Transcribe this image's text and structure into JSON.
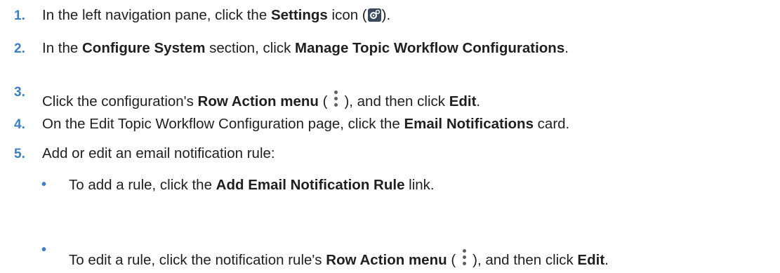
{
  "steps": [
    {
      "num": "1.",
      "parts": [
        "In the left navigation pane, click the ",
        "Settings",
        " icon (",
        ")."
      ]
    },
    {
      "num": "2.",
      "parts": [
        "In the ",
        "Configure System",
        " section, click ",
        "Manage Topic Workflow Configurations",
        "."
      ]
    },
    {
      "num": "3.",
      "parts": [
        "Click the configuration's ",
        "Row Action menu",
        " (",
        "), and then click ",
        "Edit",
        "."
      ]
    },
    {
      "num": "4.",
      "parts": [
        "On the Edit Topic Workflow Configuration page, click the ",
        "Email Notifications",
        " card."
      ]
    },
    {
      "num": "5.",
      "parts": [
        "Add or edit an email notification rule:"
      ]
    }
  ],
  "bullets": [
    {
      "symbol": "•",
      "parts": [
        "To add a rule, click the ",
        "Add Email Notification Rule",
        " link."
      ]
    },
    {
      "symbol": "•",
      "parts": [
        "To edit a rule, click the notification rule's ",
        "Row Action menu",
        " (",
        "), and then click ",
        "Edit",
        "."
      ]
    }
  ],
  "icons": {
    "settings": "settings-gear-icon",
    "row_action": "kebab-menu-icon"
  },
  "colors": {
    "number": "#3d7fc6",
    "text": "#1f1f1f"
  }
}
